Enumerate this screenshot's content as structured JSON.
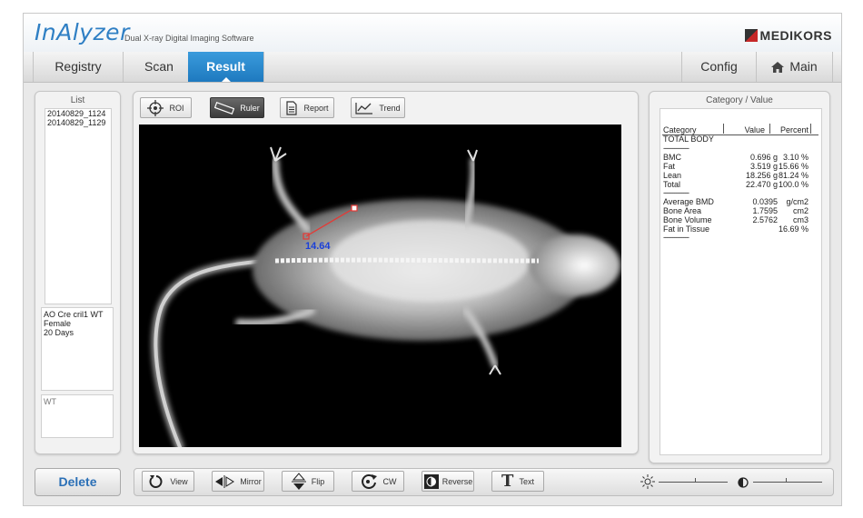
{
  "header": {
    "logo": "InAlyzer",
    "subtitle": "Dual X-ray Digital Imaging Software",
    "brand": "MEDIKORS"
  },
  "nav": {
    "tabs": [
      {
        "label": "Registry"
      },
      {
        "label": "Scan"
      },
      {
        "label": "Result"
      }
    ],
    "active_tab": "Result",
    "config": "Config",
    "main": "Main"
  },
  "list": {
    "title": "List",
    "items": [
      "20140829_1124",
      "20140829_1129"
    ],
    "info": [
      "AO Cre cril1 WT",
      "Female",
      "20 Days"
    ],
    "note": "WT"
  },
  "toolbar": {
    "roi": "ROI",
    "ruler": "Ruler",
    "report": "Report",
    "trend": "Trend"
  },
  "measurement": {
    "value": "14.64"
  },
  "category": {
    "title": "Category / Value",
    "header": {
      "category": "Category",
      "value": "Value",
      "percent": "Percent"
    },
    "section": "TOTAL BODY",
    "separator": "--------------",
    "rows": [
      {
        "name": "BMC",
        "value": "0.696 g",
        "percent": "3.10 %"
      },
      {
        "name": "Fat",
        "value": "3.519 g",
        "percent": "15.66 %"
      },
      {
        "name": "Lean",
        "value": "18.256 g",
        "percent": "81.24 %"
      },
      {
        "name": "Total",
        "value": "22.470 g",
        "percent": "100.0 %"
      }
    ],
    "rows2": [
      {
        "name": "Average BMD",
        "value": "0.0395",
        "percent": "g/cm2"
      },
      {
        "name": "Bone Area",
        "value": "1.7595",
        "percent": "cm2"
      },
      {
        "name": "Bone Volume",
        "value": "2.5762",
        "percent": "cm3"
      },
      {
        "name": "Fat in Tissue",
        "value": "",
        "percent": "16.69 %"
      }
    ]
  },
  "bottom": {
    "delete": "Delete",
    "view": "View",
    "mirror": "Mirror",
    "flip": "Flip",
    "cw": "CW",
    "reverse": "Reverse",
    "text": "Text"
  },
  "colors": {
    "accent": "#1e79bf",
    "measurement_line": "#e53935",
    "measurement_text": "#1a3fd8",
    "logo": "#2f7fc4"
  }
}
